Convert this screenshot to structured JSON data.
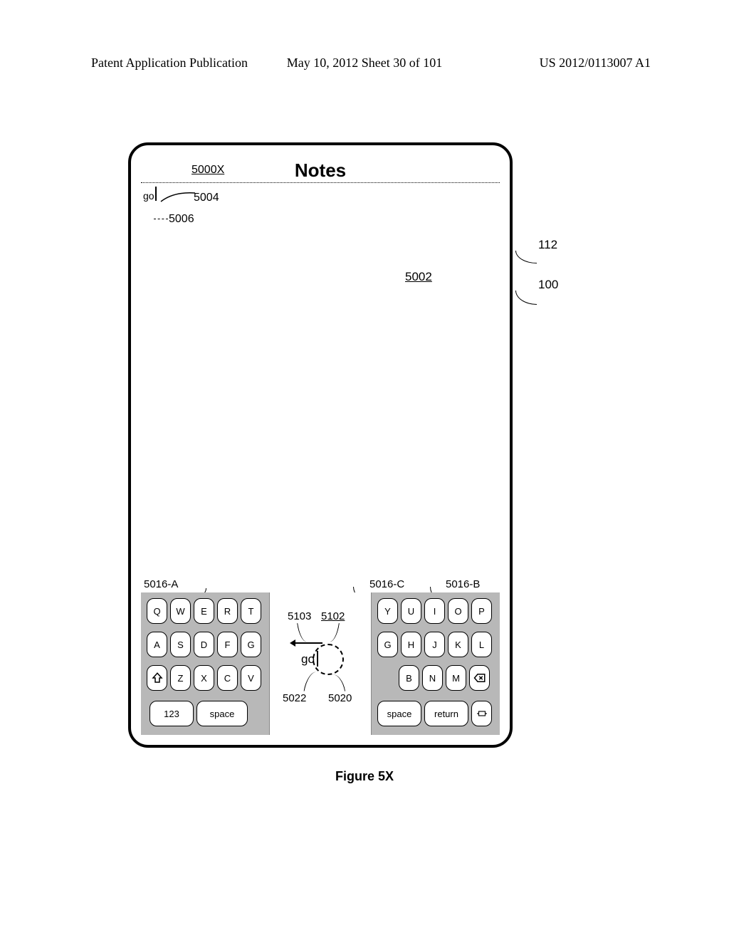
{
  "header": {
    "left": "Patent Application Publication",
    "center": "May 10, 2012  Sheet 30 of 101",
    "right": "US 2012/0113007 A1"
  },
  "device": {
    "title": "Notes",
    "typed_text": "go",
    "center_go": "go"
  },
  "refs": {
    "r5000X": "5000X",
    "r5004": "5004",
    "r5006": "5006",
    "r5002": "5002",
    "r5016A": "5016-A",
    "r5016B": "5016-B",
    "r5016C": "5016-C",
    "r5103": "5103",
    "r5102": "5102",
    "r5022": "5022",
    "r5020": "5020",
    "r112": "112",
    "r100": "100"
  },
  "kbd": {
    "left": {
      "r1": [
        "Q",
        "W",
        "E",
        "R",
        "T"
      ],
      "r2": [
        "A",
        "S",
        "D",
        "F",
        "G"
      ],
      "r3_shift": "⇧",
      "r3": [
        "Z",
        "X",
        "C",
        "V"
      ],
      "r4_123": "123",
      "r4_space": "space"
    },
    "right": {
      "r1": [
        "Y",
        "U",
        "I",
        "O",
        "P"
      ],
      "r2": [
        "G",
        "H",
        "J",
        "K",
        "L"
      ],
      "r3": [
        "B",
        "N",
        "M"
      ],
      "r3_bksp": "⌫",
      "r4_space": "space",
      "r4_return": "return",
      "r4_kbd": "⌨"
    }
  },
  "caption": "Figure 5X"
}
